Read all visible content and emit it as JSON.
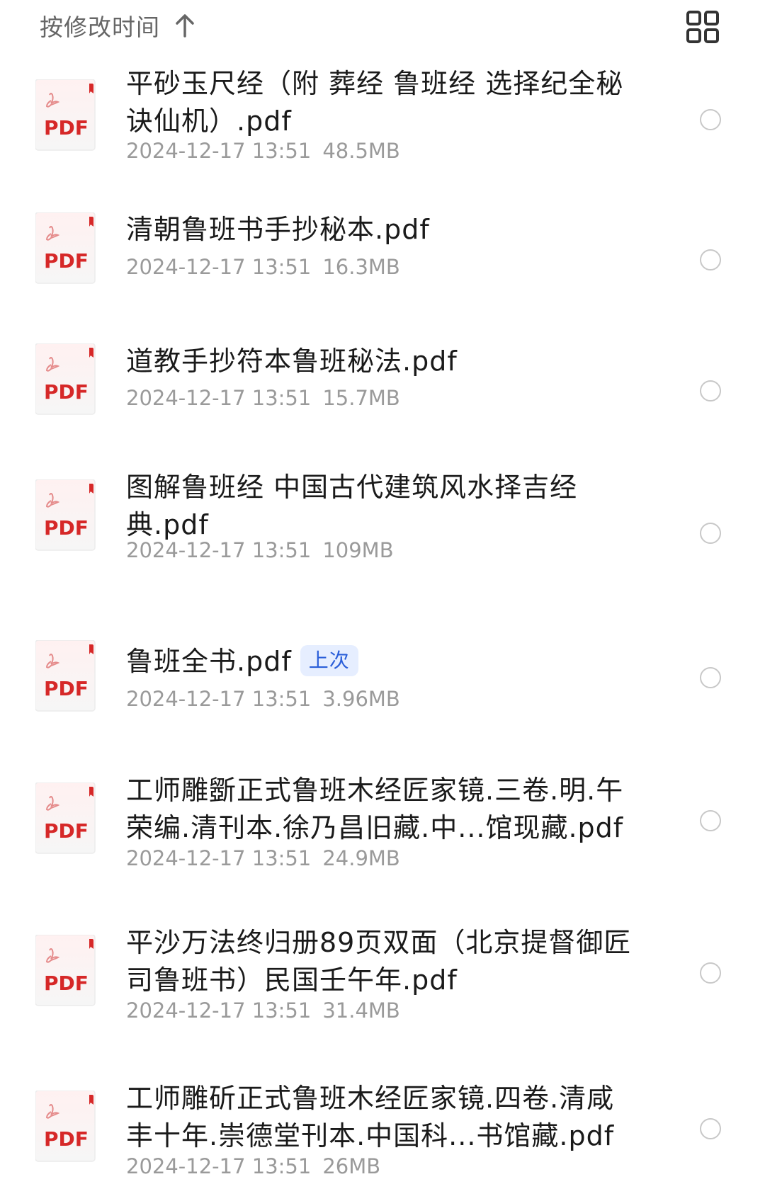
{
  "sort": {
    "label": "按修改时间",
    "direction_icon": "arrow-up-icon"
  },
  "view_toggle": {
    "icon": "grid-view-icon"
  },
  "pdf_icon_label": "PDF",
  "files": [
    {
      "name": "平砂玉尺经（附 葬经 鲁班经 选择纪全秘诀仙机）.pdf",
      "date": "2024-12-17 13:51",
      "size": "48.5MB",
      "badge": ""
    },
    {
      "name": "清朝鲁班书手抄秘本.pdf",
      "date": "2024-12-17 13:51",
      "size": "16.3MB",
      "badge": ""
    },
    {
      "name": "道教手抄符本鲁班秘法.pdf",
      "date": "2024-12-17 13:51",
      "size": "15.7MB",
      "badge": ""
    },
    {
      "name": "图解鲁班经  中国古代建筑风水择吉经典.pdf",
      "date": "2024-12-17 13:51",
      "size": "109MB",
      "badge": ""
    },
    {
      "name": "鲁班全书.pdf",
      "date": "2024-12-17 13:51",
      "size": "3.96MB",
      "badge": "上次"
    },
    {
      "name": "工师雕斵正式鲁班木经匠家镜.三卷.明.午荣编.清刊本.徐乃昌旧藏.中...馆现藏.pdf",
      "date": "2024-12-17 13:51",
      "size": "24.9MB",
      "badge": ""
    },
    {
      "name": "平沙万法终归册89页双面（北京提督御匠司鲁班书）民国壬午年.pdf",
      "date": "2024-12-17 13:51",
      "size": "31.4MB",
      "badge": ""
    },
    {
      "name": "工师雕斫正式鲁班木经匠家镜.四卷.清咸丰十年.崇德堂刊本.中国科...书馆藏.pdf",
      "date": "2024-12-17 13:51",
      "size": "26MB",
      "badge": ""
    }
  ],
  "colors": {
    "pdf_red": "#d62828",
    "badge_blue": "#2b5fd9",
    "badge_bg": "#e6eeff",
    "meta_gray": "#9a9a9a"
  }
}
